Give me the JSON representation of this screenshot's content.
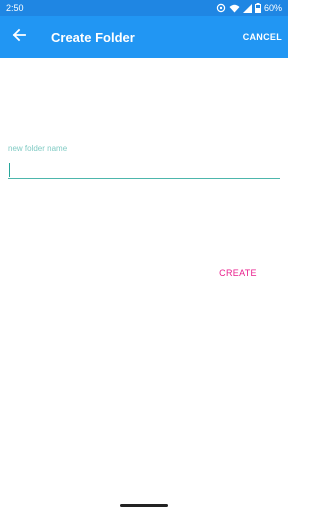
{
  "status_bar": {
    "time": "2:50",
    "battery": "60%",
    "icons": [
      "data-saver-icon",
      "wifi-icon",
      "signal-icon",
      "battery-icon"
    ]
  },
  "app_bar": {
    "title": "Create Folder",
    "cancel_label": "CANCEL",
    "back_icon": "arrow-left-icon",
    "background": "#2196f3"
  },
  "form": {
    "folder_name_label": "new folder name",
    "folder_name_value": "",
    "create_label": "CREATE",
    "accent_color": "#4db6ac",
    "create_color": "#e91e8c"
  }
}
